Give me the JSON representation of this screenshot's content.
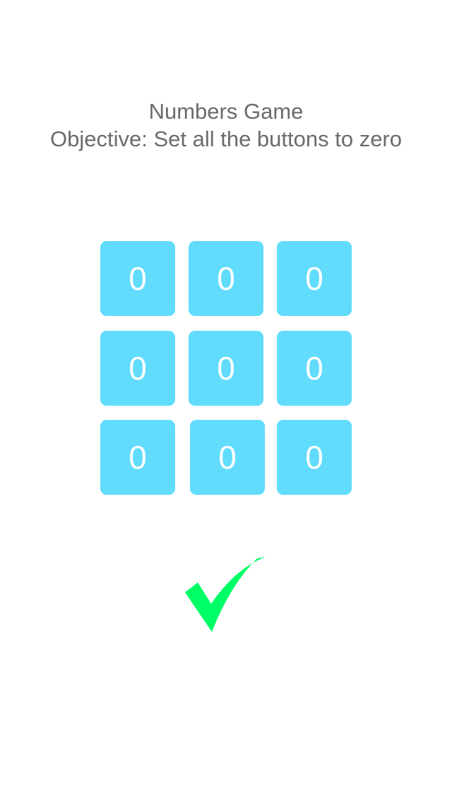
{
  "header": {
    "title": "Numbers Game",
    "objective": "Objective: Set all the buttons to zero"
  },
  "grid": {
    "tiles": [
      "0",
      "0",
      "0",
      "0",
      "0",
      "0",
      "0",
      "0",
      "0"
    ],
    "tile_color": "#61dcfc",
    "text_color": "#ffffff"
  },
  "status": {
    "icon": "checkmark-icon",
    "color": "#00ff66"
  }
}
